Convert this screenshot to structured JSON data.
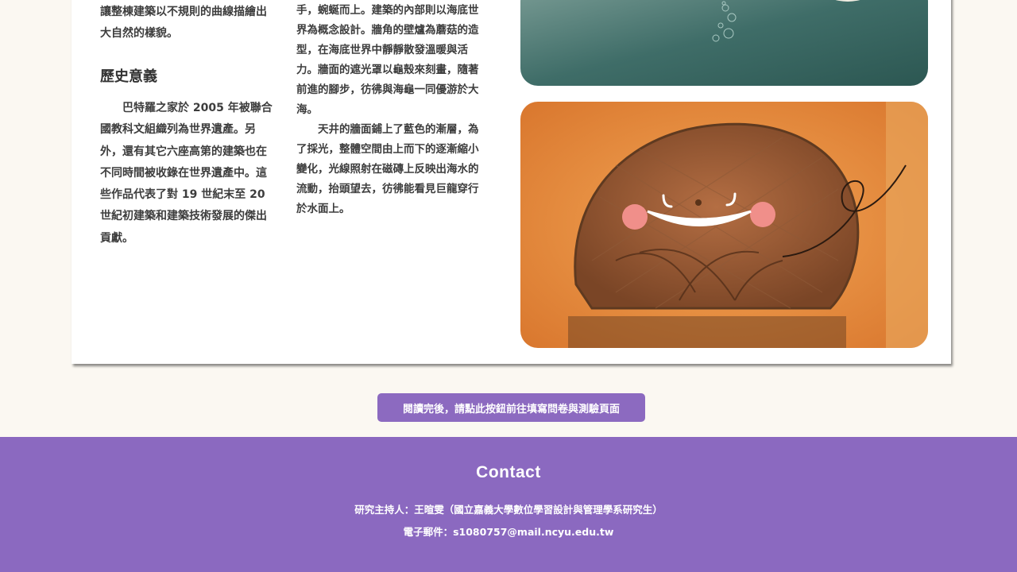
{
  "article": {
    "intro_text": "讓整棟建築以不規則的曲線描繪出大自然的樣貌。",
    "history_heading": "歷史意義",
    "history_text": "巴特羅之家於 2005 年被聯合國教科文組織列為世界遺產。另外，還有其它六座高第的建築也在不同時間被收錄在世界遺產中。這些作品代表了對 19 世紀末至 20 世紀初建築和建築技術發展的傑出貢獻。",
    "mid_para1": "手，蜿蜒而上。建築的內部則以海底世界為概念設計。牆角的壁爐為蘑菇的造型，在海底世界中靜靜散發溫暖與活力。牆面的遮光罩以龜殼來刻畫，隨著前進的腳步，彷彿與海龜一同優游於大海。",
    "mid_para2": "天井的牆面鋪上了藍色的漸層，為了採光，整體空間由上而下的逐漸縮小變化，光線照射在磁磚上反映出海水的流動，抬頭望去，彷彿能看見巨龍穿行於水面上。"
  },
  "cta": {
    "label": "閱讀完後，請點此按鈕前往填寫問卷與測驗頁面"
  },
  "footer": {
    "title": "Contact",
    "researcher": "研究主持人：王暄雯（國立嘉義大學數位學習設計與管理學系研究生）",
    "email": "電子郵件：s1080757@mail.ncyu.edu.tw"
  },
  "colors": {
    "accent": "#8b69c0",
    "page_bg": "#fbf8f2"
  }
}
